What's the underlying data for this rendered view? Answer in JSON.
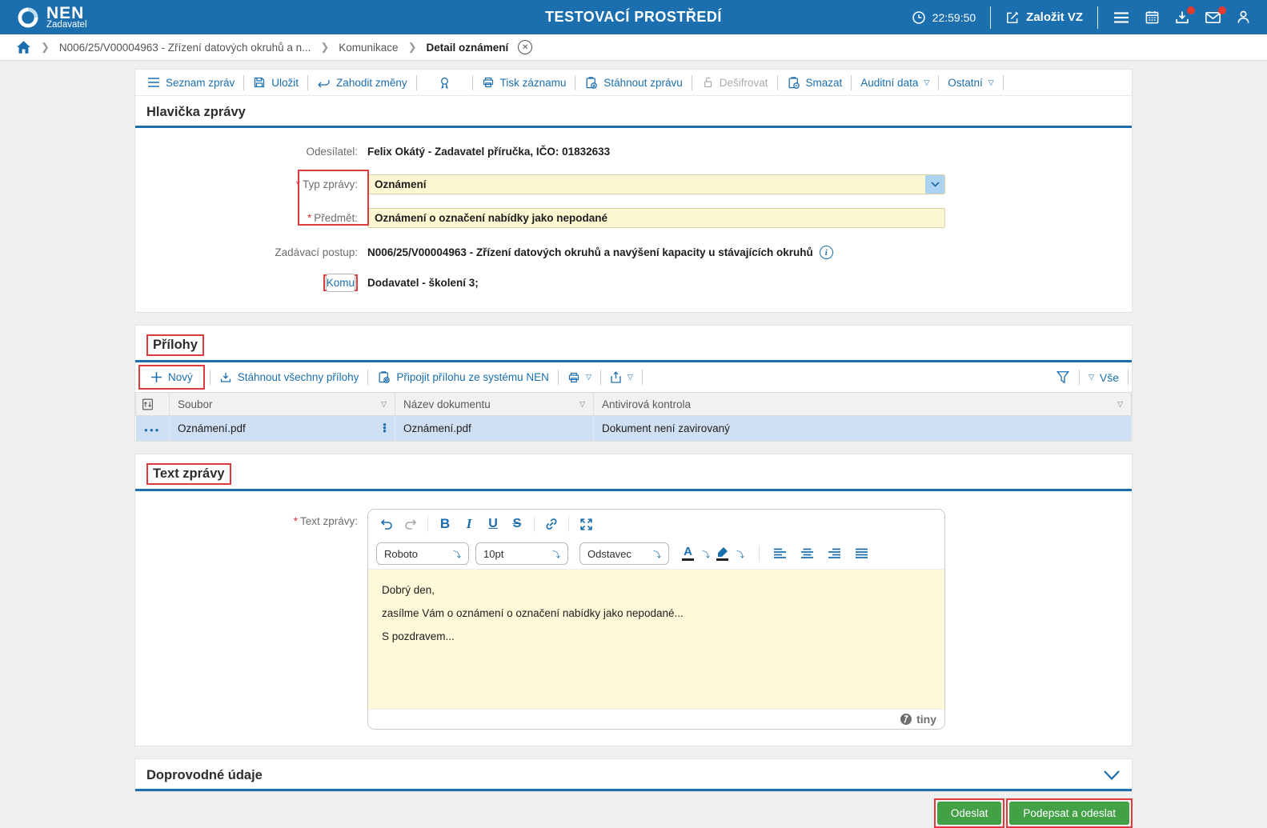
{
  "colors": {
    "header_blue": "#1b6fae",
    "accent_blue": "#1b6fae",
    "field_yellow": "#fdf7d2",
    "button_green": "#43a047",
    "annotation_red": "#e0393e",
    "row_highlight_blue": "#cfe0f5"
  },
  "header": {
    "brand": "NEN",
    "brand_sub": "Zadavatel",
    "env_title": "TESTOVACÍ PROSTŘEDÍ",
    "time": "22:59:50",
    "create_vz": "Založit VZ"
  },
  "breadcrumb": {
    "item1": "N006/25/V00004963 - Zřízení datových okruhů a n...",
    "item2": "Komunikace",
    "item3": "Detail oznámení"
  },
  "toolbar": {
    "seznam": "Seznam zpráv",
    "ulozit": "Uložit",
    "zahodit": "Zahodit změny",
    "tisk": "Tisk záznamu",
    "stahnout": "Stáhnout zprávu",
    "desifrovat": "Dešifrovat",
    "smazat": "Smazat",
    "auditni": "Auditní data",
    "ostatni": "Ostatní"
  },
  "hlavicka": {
    "title": "Hlavička zprávy",
    "required_marker": "*",
    "odesilatel_label": "Odesílatel:",
    "odesilatel_value": "Felix Okátý - Zadavatel příručka, IČO: 01832633",
    "typ_label": "Typ zprávy:",
    "typ_value": "Oznámení",
    "predmet_label": "Předmět:",
    "predmet_value": "Oznámení o označení nabídky jako nepodané",
    "postup_label": "Zadávací postup:",
    "postup_value": "N006/25/V00004963 - Zřízení datových okruhů a navýšení kapacity u stávajících okruhů",
    "komu_label": "Komu",
    "komu_value": "Dodavatel - školení 3;"
  },
  "prilohy": {
    "title": "Přílohy",
    "novy": "Nový",
    "stahnout_vse": "Stáhnout všechny přílohy",
    "pripojit": "Připojit přílohu ze systému NEN",
    "vse": "Vše",
    "col_soubor": "Soubor",
    "col_nazev": "Název dokumentu",
    "col_antivir": "Antivirová kontrola",
    "row": {
      "soubor": "Oznámení.pdf",
      "nazev": "Oznámení.pdf",
      "antivir": "Dokument není zavirovaný"
    }
  },
  "text_zpravy": {
    "title": "Text zprávy",
    "label": "Text zprávy:",
    "font_name": "Roboto",
    "font_size": "10pt",
    "block_format": "Odstavec",
    "p1": "Dobrý den,",
    "p2": "zasílme Vám o oznámení o označení nabídky jako nepodané...",
    "p3": "S pozdravem...",
    "brand": "tiny"
  },
  "doprovodne": {
    "title": "Doprovodné údaje"
  },
  "footer": {
    "odeslat": "Odeslat",
    "podepsat": "Podepsat a odeslat"
  }
}
